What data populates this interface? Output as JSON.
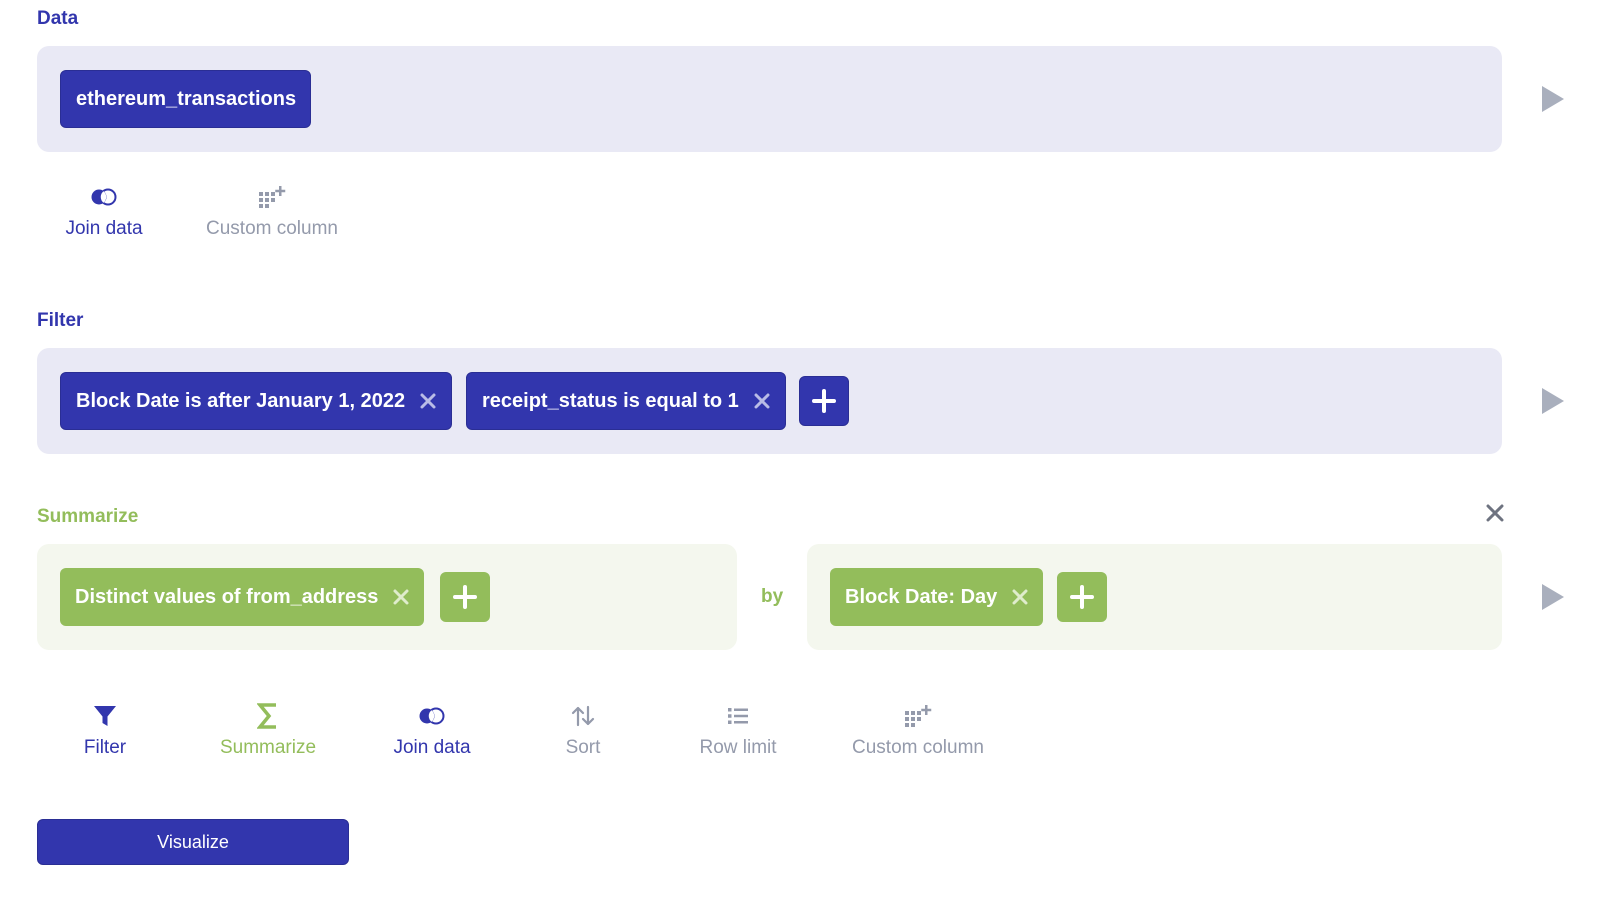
{
  "colors": {
    "data_accent": "#3236ad",
    "data_panel_bg": "#e9e9f5",
    "summarize_accent": "#93bd5b",
    "summarize_panel_bg": "#f4f7ee",
    "muted": "#949aab"
  },
  "data_section": {
    "title": "Data",
    "table_chip": "ethereum_transactions",
    "actions": [
      {
        "label": "Join data",
        "icon": "join-icon"
      },
      {
        "label": "Custom column",
        "icon": "custom-column-icon"
      }
    ]
  },
  "filter_section": {
    "title": "Filter",
    "filters": [
      {
        "label": "Block Date is after January 1, 2022"
      },
      {
        "label": "receipt_status is equal to 1"
      }
    ]
  },
  "summarize_section": {
    "title": "Summarize",
    "metric_chip": "Distinct values of from_address",
    "by_label": "by",
    "group_chip": "Block Date: Day"
  },
  "bottom_actions": [
    {
      "label": "Filter",
      "icon": "filter-icon"
    },
    {
      "label": "Summarize",
      "icon": "sigma-icon"
    },
    {
      "label": "Join data",
      "icon": "join-icon"
    },
    {
      "label": "Sort",
      "icon": "sort-icon"
    },
    {
      "label": "Row limit",
      "icon": "list-icon"
    },
    {
      "label": "Custom column",
      "icon": "custom-column-icon"
    }
  ],
  "visualize_button": "Visualize"
}
